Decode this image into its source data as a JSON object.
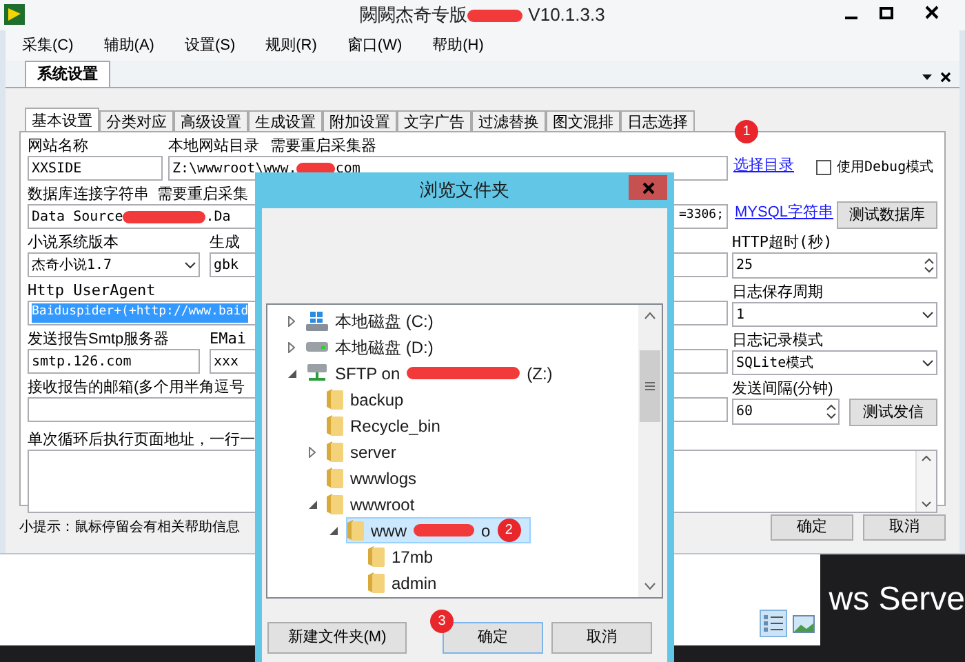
{
  "window": {
    "title": "闕闕杰奇专版",
    "version": "V10.1.3.3"
  },
  "menu": [
    "采集(C)",
    "辅助(A)",
    "设置(S)",
    "规则(R)",
    "窗口(W)",
    "帮助(H)"
  ],
  "document_tab": {
    "label": "系统设置"
  },
  "tabs": [
    {
      "label": "基本设置",
      "selected": true
    },
    {
      "label": "分类对应",
      "selected": false
    },
    {
      "label": "高级设置",
      "selected": false
    },
    {
      "label": "生成设置",
      "selected": false
    },
    {
      "label": "附加设置",
      "selected": false
    },
    {
      "label": "文字广告",
      "selected": false
    },
    {
      "label": "过滤替换",
      "selected": false
    },
    {
      "label": "图文混排",
      "selected": false
    },
    {
      "label": "日志选择",
      "selected": false
    }
  ],
  "form": {
    "site_name": {
      "label": "网站名称",
      "value": "XXSIDE"
    },
    "local_dir": {
      "label": "本地网站目录",
      "note": "需要重启采集器",
      "value_start": "Z:\\wwwroot\\www.",
      "value_end": "com",
      "link": "选择目录",
      "badge": "1"
    },
    "debug": {
      "label": "使用Debug模式",
      "checked": false
    },
    "database": {
      "label": "数据库连接字符串",
      "note": "需要重启采集",
      "value_start": "Data Source",
      "value_mid": ".Da",
      "value_end": "=3306;",
      "link": "MYSQL字符串",
      "button": "测试数据库"
    },
    "novel_version": {
      "label": "小说系统版本",
      "value": "杰奇小说1.7"
    },
    "encoding": {
      "label": "生成",
      "value": "gbk"
    },
    "user_agent": {
      "label": "Http UserAgent",
      "value": "Baiduspider+(+http://www.baid"
    },
    "smtp": {
      "label": "发送报告Smtp服务器",
      "value": "smtp.126.com"
    },
    "email": {
      "label": "EMai",
      "value": "xxx"
    },
    "recipients": {
      "label": "接收报告的邮箱(多个用半角逗号"
    },
    "http_timeout": {
      "label": "HTTP超时(秒)",
      "value": "25"
    },
    "log_period": {
      "label": "日志保存周期",
      "value": "1"
    },
    "log_mode": {
      "label": "日志记录模式",
      "value": "SQLite模式"
    },
    "send_interval": {
      "label": "发送间隔(分钟)",
      "value": "60",
      "button": "测试发信"
    },
    "loop_urls": {
      "label": "单次循环后执行页面地址，一行一"
    },
    "hint": "小提示：鼠标停留会有相关帮助信息",
    "buttons": [
      "确定",
      "取消"
    ]
  },
  "dialog": {
    "title": "浏览文件夹",
    "tree": [
      {
        "kind": "system-drive",
        "label": "本地磁盘 (C:)",
        "expanded": false,
        "selected": false
      },
      {
        "kind": "drive",
        "label": "本地磁盘 (D:)",
        "expanded": false,
        "selected": false
      },
      {
        "kind": "network-drive",
        "label": "SFTP on",
        "suffix": "(Z:)",
        "redacted": true,
        "expanded": true,
        "selected": false,
        "children": [
          {
            "kind": "folder",
            "label": "backup",
            "selected": false
          },
          {
            "kind": "folder",
            "label": "Recycle_bin",
            "selected": false
          },
          {
            "kind": "folder",
            "label": "server",
            "expanded": false,
            "selected": false
          },
          {
            "kind": "folder",
            "label": "wwwlogs",
            "selected": false
          },
          {
            "kind": "folder",
            "label": "wwwroot",
            "expanded": true,
            "selected": false,
            "children": [
              {
                "kind": "folder",
                "label": "www",
                "suffix": "o",
                "redacted": true,
                "badge": "2",
                "expanded": true,
                "selected": true,
                "children": [
                  {
                    "kind": "folder",
                    "label": "17mb",
                    "selected": false
                  },
                  {
                    "kind": "folder",
                    "label": "admin",
                    "selected": false
                  }
                ]
              }
            ]
          }
        ]
      }
    ],
    "buttons": [
      {
        "label": "新建文件夹(M)"
      },
      {
        "label": "确定",
        "badge": "3"
      },
      {
        "label": "取消"
      }
    ]
  },
  "desktop": {
    "text": "ws Serve"
  }
}
